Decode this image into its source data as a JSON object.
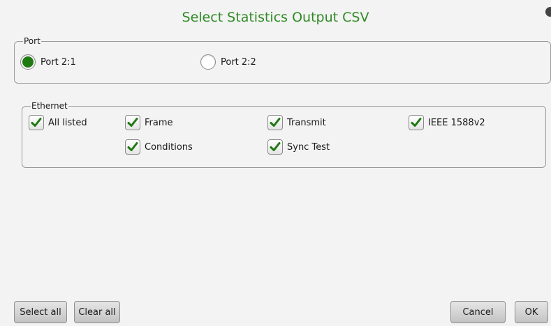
{
  "dialog": {
    "title": "Select Statistics Output CSV"
  },
  "port_group": {
    "legend": "Port",
    "options": [
      {
        "label": "Port 2:1",
        "selected": true
      },
      {
        "label": "Port 2:2",
        "selected": false
      }
    ]
  },
  "ethernet_group": {
    "legend": "Ethernet",
    "options": [
      {
        "label": "All listed",
        "checked": true
      },
      {
        "label": "Frame",
        "checked": true
      },
      {
        "label": "Transmit",
        "checked": true
      },
      {
        "label": "IEEE 1588v2",
        "checked": true
      },
      {
        "label": "Conditions",
        "checked": true
      },
      {
        "label": "Sync Test",
        "checked": true
      }
    ]
  },
  "buttons": {
    "select_all": "Select all",
    "clear_all": "Clear all",
    "cancel": "Cancel",
    "ok": "OK"
  },
  "colors": {
    "accent": "#2e8b24",
    "check": "#1f7a12"
  },
  "icons": {
    "checkmark": "checkmark-icon",
    "radio": "radio-dot-icon"
  }
}
